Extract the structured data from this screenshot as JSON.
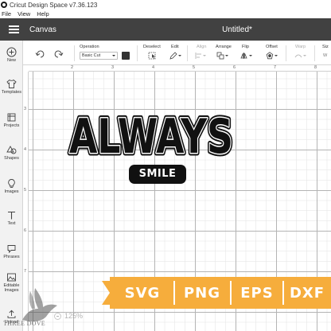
{
  "window": {
    "title": "Cricut Design Space  v7.36.123"
  },
  "menubar": {
    "items": [
      "File",
      "View",
      "Help"
    ]
  },
  "header": {
    "canvas_label": "Canvas",
    "doc_title": "Untitled*"
  },
  "sidebar": {
    "items": [
      {
        "label": "New",
        "icon": "plus-circle-icon"
      },
      {
        "label": "Templates",
        "icon": "shirt-icon"
      },
      {
        "label": "Projects",
        "icon": "projects-icon"
      },
      {
        "label": "Shapes",
        "icon": "shapes-icon"
      },
      {
        "label": "Images",
        "icon": "lightbulb-icon"
      },
      {
        "label": "Text",
        "icon": "text-icon"
      },
      {
        "label": "Phrases",
        "icon": "speech-bubble-icon"
      },
      {
        "label": "Editable Images",
        "icon": "editable-images-icon"
      },
      {
        "label": "Upload",
        "icon": "upload-icon"
      }
    ]
  },
  "toolbar": {
    "operation_label": "Operation",
    "operation_value": "Basic Cut",
    "operation_color": "#333333",
    "deselect_label": "Deselect",
    "edit_label": "Edit",
    "align_label": "Align",
    "arrange_label": "Arrange",
    "flip_label": "Flip",
    "offset_label": "Offset",
    "warp_label": "Warp",
    "size_label": "Siz",
    "size_sub": "W"
  },
  "rulers": {
    "top": [
      "2",
      "3",
      "4",
      "5",
      "6",
      "7",
      "8"
    ],
    "left": [
      "3",
      "4",
      "5",
      "6",
      "7"
    ]
  },
  "artwork": {
    "headline": "ALWAYS",
    "subline": "SMILE",
    "ink_color": "#111111"
  },
  "formats": {
    "items": [
      "SVG",
      "PNG",
      "EPS",
      "DXF"
    ],
    "color": "#f6ad3c"
  },
  "zoom": {
    "value": "125%"
  },
  "watermark": {
    "text": "THREE DOVE"
  }
}
